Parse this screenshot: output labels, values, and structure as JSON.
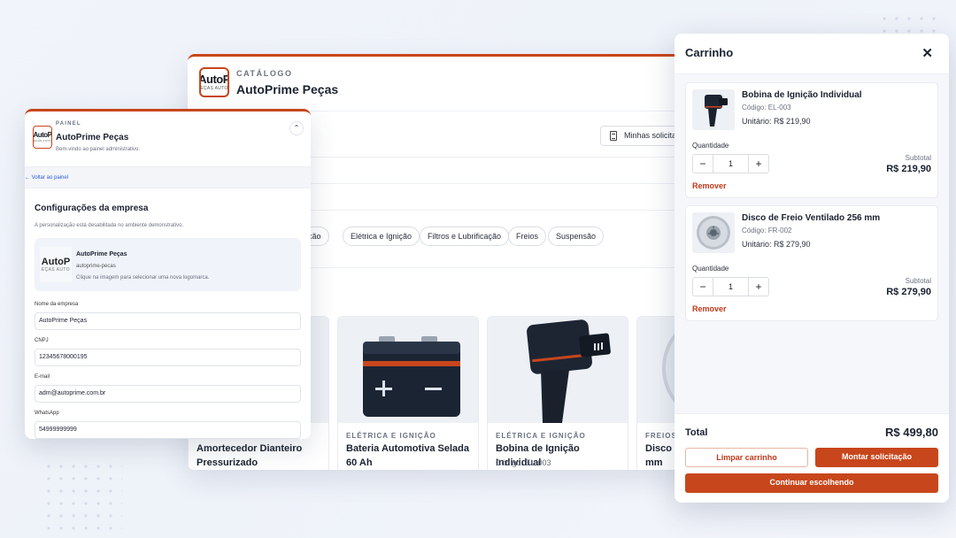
{
  "colors": {
    "accent": "#c8461c",
    "link": "#2d5bd8",
    "text": "#1b2130"
  },
  "brand": {
    "logo_main": "AutoP",
    "logo_sub": "EÇAS AUTO",
    "logo_thumb_main": "AutoP",
    "logo_thumb_sub": "EÇAS AUTO"
  },
  "catalog": {
    "eyebrow": "CATÁLOGO",
    "title": "AutoPrime Peças",
    "my_requests_label": "Minhas solicita",
    "categories": [
      "enção",
      "Elétrica e Ignição",
      "Filtros e Lubrificação",
      "Freios",
      "Suspensão"
    ],
    "products": [
      {
        "category": "",
        "name": "Amortecedor Dianteiro Pressurizado",
        "code": "",
        "image_icon": "shock-absorber-image"
      },
      {
        "category": "ELÉTRICA E IGNIÇÃO",
        "name": "Bateria Automotiva Selada 60 Ah",
        "code": "",
        "image_icon": "battery-image"
      },
      {
        "category": "ELÉTRICA E IGNIÇÃO",
        "name": "Bobina de Ignição Individual",
        "code": "Código: EL-003",
        "image_icon": "ignition-coil-image"
      },
      {
        "category": "FREIOS",
        "name": "Disco d",
        "name_line2": "mm",
        "code": "",
        "image_icon": "brake-disc-image"
      }
    ]
  },
  "panel": {
    "eyebrow": "PAINEL",
    "title": "AutoPrime Peças",
    "subtitle": "Bem-vindo ao painel administrativo.",
    "collapse_icon": "chevrons-up-icon",
    "back_link": "← Voltar ao painel",
    "section_title": "Configurações da empresa",
    "section_note": "A personalização está desabilitada no ambiente demonstrativo.",
    "logo_card": {
      "name": "AutoPrime Peças",
      "slug": "autoprime-pecas",
      "hint": "Clique na imagem para selecionar uma nova logomarca."
    },
    "fields": [
      {
        "label": "Nome da empresa",
        "value": "AutoPrime Peças"
      },
      {
        "label": "CNPJ",
        "value": "12345678000195"
      },
      {
        "label": "E-mail",
        "value": "adm@autoprime.com.br"
      },
      {
        "label": "WhatsApp",
        "value": "54999999999"
      }
    ]
  },
  "cart": {
    "title": "Carrinho",
    "close_icon": "close-icon",
    "items": [
      {
        "name": "Bobina de Ignição Individual",
        "code": "Código: EL-003",
        "unit_price": "Unitário: R$ 219,90",
        "quantity_label": "Quantidade",
        "quantity": "1",
        "minus": "−",
        "plus": "+",
        "remove_label": "Remover",
        "subtotal_label": "Subtotal",
        "subtotal": "R$ 219,90",
        "image_icon": "ignition-coil-image"
      },
      {
        "name": "Disco de Freio Ventilado 256 mm",
        "code": "Código: FR-002",
        "unit_price": "Unitário: R$ 279,90",
        "quantity_label": "Quantidade",
        "quantity": "1",
        "minus": "−",
        "plus": "+",
        "remove_label": "Remover",
        "subtotal_label": "Subtotal",
        "subtotal": "R$ 279,90",
        "image_icon": "brake-disc-image"
      }
    ],
    "total_label": "Total",
    "total_value": "R$ 499,80",
    "clear_label": "Limpar carrinho",
    "submit_label": "Montar solicitação",
    "continue_label": "Continuar escolhendo"
  }
}
